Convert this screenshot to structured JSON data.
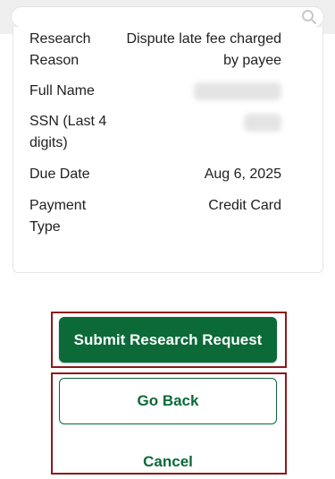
{
  "search": {
    "placeholder": "",
    "icon": "search-icon"
  },
  "details": {
    "research_reason_label": "Research Reason",
    "research_reason_value": "Dispute late fee charged by payee",
    "full_name_label": "Full Name",
    "ssn_label": "SSN (Last 4 digits)",
    "due_date_label": "Due Date",
    "due_date_value": "Aug 6, 2025",
    "payment_type_label": "Payment Type",
    "payment_type_value": "Credit Card"
  },
  "actions": {
    "submit_label": "Submit Research Request",
    "go_back_label": "Go Back",
    "cancel_label": "Cancel"
  },
  "colors": {
    "brand_green": "#0b6a38",
    "highlight_frame": "#8b1a1a"
  }
}
